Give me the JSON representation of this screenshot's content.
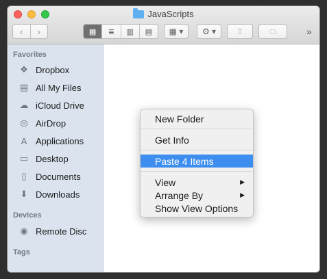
{
  "window": {
    "title": "JavaScripts"
  },
  "toolbar": {
    "back": "‹",
    "forward": "›",
    "views": [
      "▦",
      "≣",
      "▥",
      "▤"
    ],
    "arrange": "▦ ▾",
    "action": "⚙ ▾",
    "share": "⇧",
    "tag": "⬭",
    "overflow": "»"
  },
  "sidebar": {
    "favorites_title": "Favorites",
    "favorites": [
      {
        "label": "Dropbox",
        "icon": "dropbox-icon",
        "glyph": "❖"
      },
      {
        "label": "All My Files",
        "icon": "all-files-icon",
        "glyph": "▤"
      },
      {
        "label": "iCloud Drive",
        "icon": "cloud-icon",
        "glyph": "☁"
      },
      {
        "label": "AirDrop",
        "icon": "airdrop-icon",
        "glyph": "◎"
      },
      {
        "label": "Applications",
        "icon": "applications-icon",
        "glyph": "A"
      },
      {
        "label": "Desktop",
        "icon": "desktop-icon",
        "glyph": "▭"
      },
      {
        "label": "Documents",
        "icon": "documents-icon",
        "glyph": "▯"
      },
      {
        "label": "Downloads",
        "icon": "downloads-icon",
        "glyph": "⬇"
      }
    ],
    "devices_title": "Devices",
    "devices": [
      {
        "label": "Remote Disc",
        "icon": "disc-icon",
        "glyph": "◉"
      }
    ],
    "tags_title": "Tags"
  },
  "context_menu": {
    "new_folder": "New Folder",
    "get_info": "Get Info",
    "paste": "Paste 4 Items",
    "view": "View",
    "arrange_by": "Arrange By",
    "show_view_options": "Show View Options",
    "submenu_arrow": "▶"
  },
  "colors": {
    "selection": "#3d8eef",
    "sidebar_bg": "#dae3ee",
    "folder": "#5fb0f0"
  }
}
